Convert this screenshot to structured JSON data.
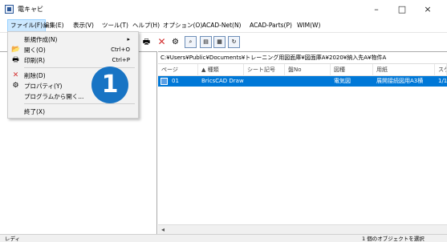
{
  "window": {
    "title": "電キャビ",
    "minimize": "–",
    "maximize": "□",
    "close": "×"
  },
  "menubar": [
    "ファイル(F)",
    "編集(E)",
    "表示(V)",
    "ツール(T)",
    "ヘルプ(H)",
    "オプション(O)",
    "ACAD-Net(N)",
    "ACAD-Parts(P)",
    "WIM(W)"
  ],
  "file_menu": {
    "new": "新規作成(N)",
    "new_arrow": "▸",
    "open": "開く(O)",
    "open_shortcut": "Ctrl+O",
    "print": "印刷(R)",
    "print_shortcut": "Ctrl+P",
    "delete": "削除(D)",
    "properties": "プロパティ(Y)",
    "open_with": "プログラムから開く...",
    "exit": "終了(X)"
  },
  "path": "C:¥Users¥Public¥Documents¥トレーニング用図面庫¥図面庫A¥2020¥納入先A¥物件A",
  "columns": [
    "ページ",
    "▲ 種類",
    "シート記号",
    "盤No",
    "図種",
    "用紙",
    "スケ"
  ],
  "rows": [
    {
      "page": "01",
      "type": "BricsCAD Draw",
      "sheet": "",
      "panel": "",
      "kind": "電気図",
      "paper": "展開接続図用A3横",
      "scale": "1/1"
    }
  ],
  "status": {
    "left": "レディ",
    "right": "1 個のオブジェクトを選択"
  },
  "badge": "1",
  "colors": {
    "selection": "#0078d7",
    "badge": "#1874c4",
    "delete_icon": "#d32f2f"
  }
}
